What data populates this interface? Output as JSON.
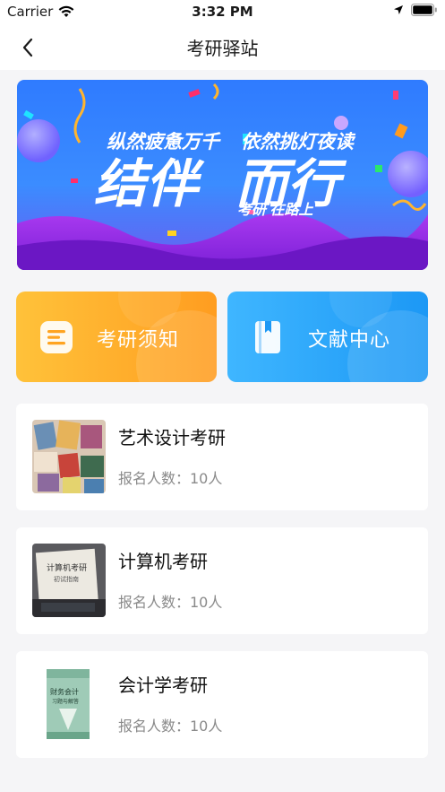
{
  "status_bar": {
    "carrier": "Carrier",
    "time": "3:32 PM"
  },
  "nav": {
    "title": "考研驿站"
  },
  "banner": {
    "line1_left": "纵然疲惫万千",
    "line1_right": "依然挑灯夜读",
    "headline_a": "结伴",
    "headline_b": "而行",
    "tagline": "考研  在路上"
  },
  "quick_links": [
    {
      "label": "考研须知",
      "icon": "notice-list-icon"
    },
    {
      "label": "文献中心",
      "icon": "book-icon"
    }
  ],
  "courses": [
    {
      "title": "艺术设计考研",
      "enroll_label": "报名人数：10人"
    },
    {
      "title": "计算机考研",
      "enroll_label": "报名人数：10人"
    },
    {
      "title": "会计学考研",
      "enroll_label": "报名人数：10人"
    }
  ],
  "book_cover": {
    "cs_title": "计算机考研",
    "cs_sub": "初试指南",
    "acc_title": "财务会计",
    "acc_sub": "习题与解答"
  },
  "colors": {
    "orange": "#ff9d20",
    "blue": "#1c98f5",
    "banner_blue": "#2f7bff"
  }
}
